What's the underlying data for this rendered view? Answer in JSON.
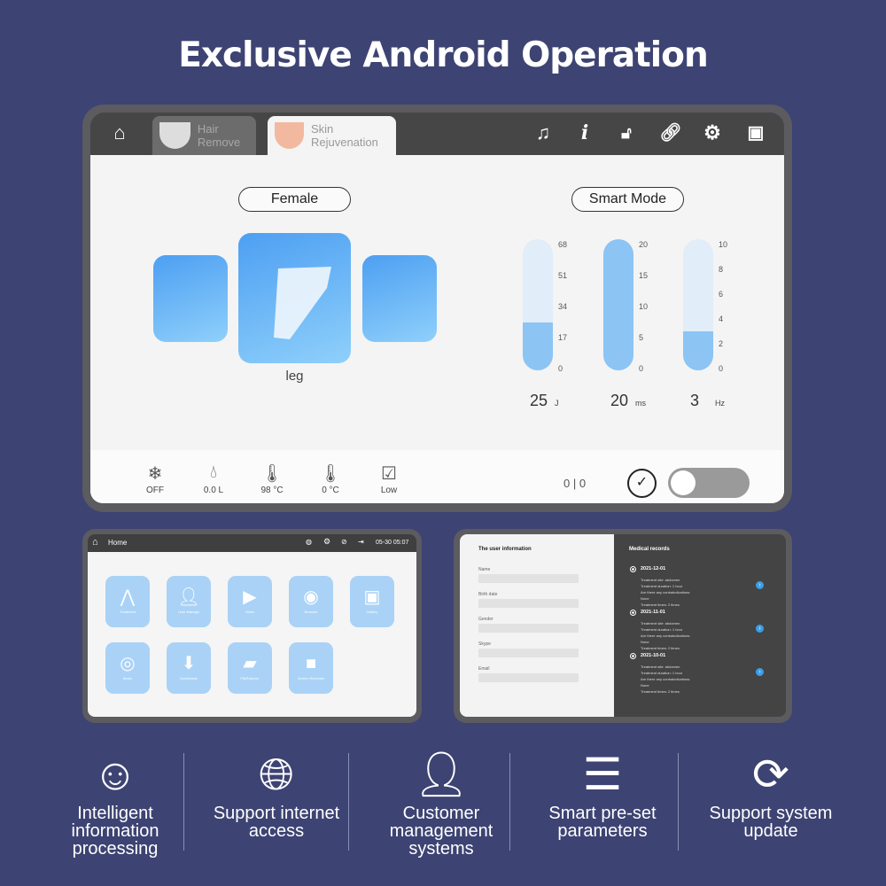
{
  "title": "Exclusive Android Operation",
  "main_screen": {
    "tabs": [
      {
        "label": "Hair Remove",
        "active": false
      },
      {
        "label": "Skin Rejuvenation",
        "active": true
      }
    ],
    "toolbar_icons": [
      "home-icon",
      "music-icon",
      "info-icon",
      "lock-off-icon",
      "link-icon",
      "gear-icon",
      "user-card-icon"
    ],
    "gender": "Female",
    "mode": "Smart Mode",
    "body_parts": [
      {
        "icon": "underarm-icon"
      },
      {
        "icon": "leg-icon",
        "label": "leg",
        "selected": true
      },
      {
        "icon": "torso-icon"
      }
    ],
    "sliders": [
      {
        "value": "25",
        "unit": "J",
        "max": 68,
        "level": 25,
        "ticks": [
          "68",
          "51",
          "34",
          "17",
          "0"
        ]
      },
      {
        "value": "20",
        "unit": "ms",
        "max": 20,
        "level": 20,
        "ticks": [
          "20",
          "15",
          "10",
          "5",
          "0"
        ]
      },
      {
        "value": "3",
        "unit": "Hz",
        "max": 10,
        "level": 3,
        "ticks": [
          "10",
          "8",
          "6",
          "4",
          "2",
          "0"
        ]
      }
    ],
    "status": [
      {
        "icon": "snowflake-icon",
        "label": "OFF"
      },
      {
        "icon": "water-drop-icon",
        "label": "0.0 L"
      },
      {
        "icon": "water-temperature-icon",
        "label": "98 °C"
      },
      {
        "icon": "thermometer-icon",
        "label": "0 °C"
      },
      {
        "icon": "water-level-icon",
        "label": "Low"
      }
    ],
    "counter": "0 | 0",
    "toggle_on": false,
    "accent": "#8cc4f4"
  },
  "home_screen": {
    "title": "Home",
    "datetime": "05-30 05:07",
    "apps": [
      "Treatment",
      "User Manage",
      "Video",
      "Browser",
      "Gallery",
      "Music",
      "Downloads",
      "FileExplorer",
      "Screen Recorder"
    ]
  },
  "user_screen": {
    "left_title": "The user information",
    "fields": [
      "Name",
      "Birth date",
      "Gender",
      "Skype",
      "Email"
    ],
    "right_title": "Medical records",
    "records": [
      {
        "date": "2021-12-01",
        "lines": [
          "Treatment site: abdomen",
          "Treatment duration: 1 hour",
          "Are there any contraindications:",
          "None",
          "Treatment times: 2 times"
        ]
      },
      {
        "date": "2021-11-01",
        "lines": [
          "Treatment site: abdomen",
          "Treatment duration: 1 hour",
          "Are there any contraindications:",
          "None",
          "Treatment times: 2 times"
        ]
      },
      {
        "date": "2021-10-01",
        "lines": [
          "Treatment site: abdomen",
          "Treatment duration: 1 hour",
          "Are there any contraindications:",
          "None",
          "Treatment times: 2 times"
        ]
      }
    ]
  },
  "features": [
    {
      "icon": "ai-head-icon",
      "label": "Intelligent information processing"
    },
    {
      "icon": "globe-icon",
      "label": "Support internet access"
    },
    {
      "icon": "user-card-icon",
      "label": "Customer management systems"
    },
    {
      "icon": "sliders-icon",
      "label": "Smart pre-set parameters"
    },
    {
      "icon": "sync-icon",
      "label": "Support  system update"
    }
  ],
  "background": "#3d4372"
}
